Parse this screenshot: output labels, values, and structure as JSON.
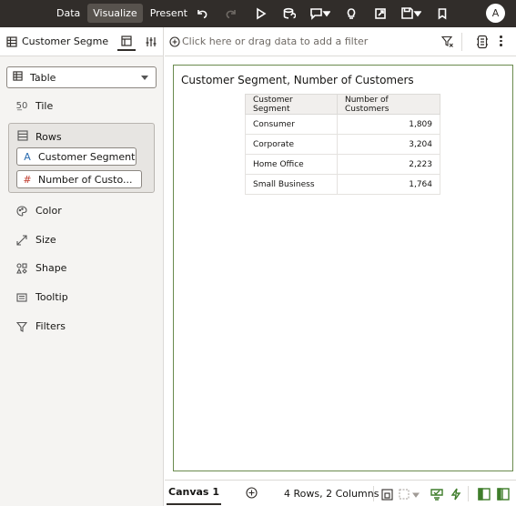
{
  "topbar": {
    "tabs": [
      {
        "label": "Data"
      },
      {
        "label": "Visualize"
      },
      {
        "label": "Present"
      }
    ],
    "avatar_initial": "A"
  },
  "left_panel": {
    "title": "Customer Segme...",
    "viz_type": "Table",
    "tile_label": "Tile",
    "rows_label": "Rows",
    "row_pills": [
      {
        "label": "Customer Segment",
        "type_glyph": "A"
      },
      {
        "label": "Number of Custo...",
        "type_glyph": "#"
      }
    ],
    "grammar": {
      "color": "Color",
      "size": "Size",
      "shape": "Shape",
      "tooltip": "Tooltip",
      "filters": "Filters"
    }
  },
  "filterbar": {
    "placeholder": "Click here or drag data to add a filter"
  },
  "visualization": {
    "title": "Customer Segment, Number of Customers",
    "columns": [
      "Customer Segment",
      "Number of Customers"
    ],
    "rows": [
      {
        "segment": "Consumer",
        "customers": "1,809"
      },
      {
        "segment": "Corporate",
        "customers": "3,204"
      },
      {
        "segment": "Home Office",
        "customers": "2,223"
      },
      {
        "segment": "Small Business",
        "customers": "1,764"
      }
    ]
  },
  "bottombar": {
    "canvas_tab": "Canvas 1",
    "status": "4 Rows, 2 Columns"
  },
  "colors": {
    "topbar_bg": "#312d2a",
    "canvas_border": "#6a8a4e",
    "accent_green": "#3f7d2b"
  }
}
